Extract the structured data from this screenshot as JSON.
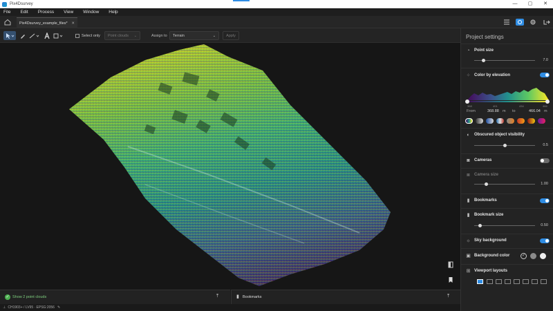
{
  "window": {
    "title": "Pix4Dsurvey",
    "controls": [
      "—",
      "▢",
      "✕"
    ]
  },
  "menu": [
    "File",
    "Edit",
    "Process",
    "View",
    "Window",
    "Help"
  ],
  "tabs": [
    {
      "label": "Pix4Dsurvey_example_files*"
    }
  ],
  "toolbar": {
    "select_only_label": "Select only",
    "select_only_checked": false,
    "point_clouds_label": "Point clouds",
    "assign_to_label": "Assign to",
    "assign_to_value": "Terrain",
    "apply_label": "Apply"
  },
  "bottom": {
    "show_point_clouds": "Show 2 point clouds",
    "bookmarks": "Bookmarks"
  },
  "status": {
    "crs": "CH1903+ / LV95 · EPSG:2056"
  },
  "panel": {
    "title": "Project settings",
    "point_size": {
      "label": "Point size",
      "value": "7.0",
      "fraction": 0.15
    },
    "color_by_elevation": {
      "label": "Color by elevation",
      "enabled": true,
      "axis_ticks": [
        "368",
        "401",
        "434",
        "466"
      ],
      "from_label": "From",
      "from_value": "368.88",
      "from_unit": "m",
      "to_label": "to",
      "to_value": "466.04",
      "to_unit": "m"
    },
    "obscured_visibility": {
      "label": "Obscured object visibility",
      "value": "0.5",
      "fraction": 0.5
    },
    "cameras": {
      "label": "Cameras",
      "enabled": false
    },
    "camera_size": {
      "label": "Camera size",
      "value": "1.00",
      "fraction": 0.2
    },
    "bookmarks": {
      "label": "Bookmarks",
      "enabled": true
    },
    "bookmark_size": {
      "label": "Bookmark size",
      "value": "0.50",
      "fraction": 0.1
    },
    "sky_background": {
      "label": "Sky background",
      "enabled": true
    },
    "background_color": {
      "label": "Background color"
    },
    "viewport_layouts": {
      "label": "Viewport layouts"
    }
  },
  "colors": {
    "accent": "#2f8de4",
    "panel_bg": "#232323",
    "viewport_bg": "#161616"
  }
}
